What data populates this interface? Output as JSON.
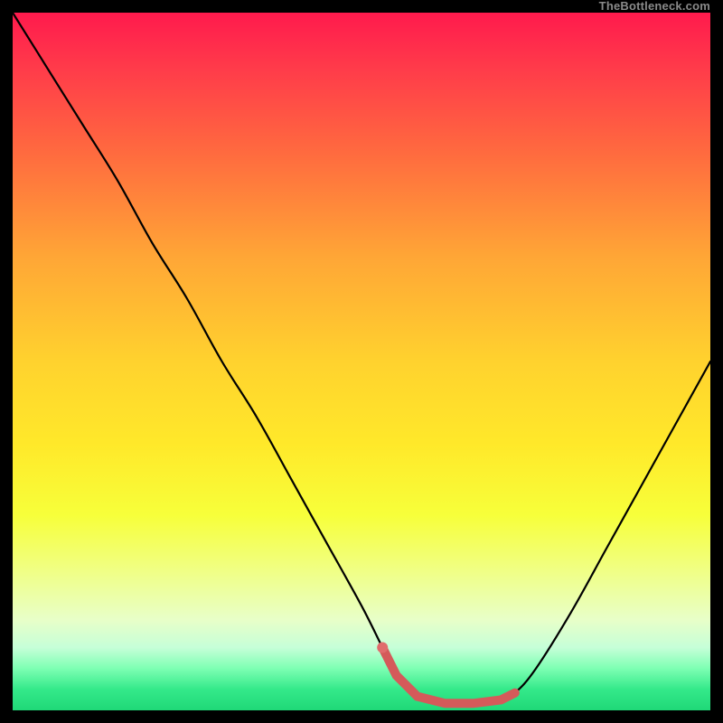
{
  "watermark": "TheBottleneck.com",
  "colors": {
    "curve_stroke": "#000000",
    "highlight_fill": "#e06c6c",
    "highlight_stroke": "#d45a5a",
    "frame": "#000000"
  },
  "chart_data": {
    "type": "line",
    "title": "",
    "xlabel": "",
    "ylabel": "",
    "xlim": [
      0,
      100
    ],
    "ylim": [
      0,
      100
    ],
    "grid": false,
    "legend": false,
    "series": [
      {
        "name": "bottleneck-curve",
        "x": [
          0,
          5,
          10,
          15,
          20,
          25,
          30,
          35,
          40,
          45,
          50,
          53,
          55,
          58,
          62,
          66,
          70,
          72,
          75,
          80,
          85,
          90,
          95,
          100
        ],
        "values": [
          100,
          92,
          84,
          76,
          67,
          59,
          50,
          42,
          33,
          24,
          15,
          9,
          5,
          2,
          1,
          1,
          1.5,
          2.5,
          6,
          14,
          23,
          32,
          41,
          50
        ]
      }
    ],
    "annotations": [
      {
        "name": "optimal-range",
        "type": "highlight-segment",
        "x_start": 53,
        "x_end": 72,
        "marker_x": 53,
        "marker_value": 9
      }
    ]
  }
}
